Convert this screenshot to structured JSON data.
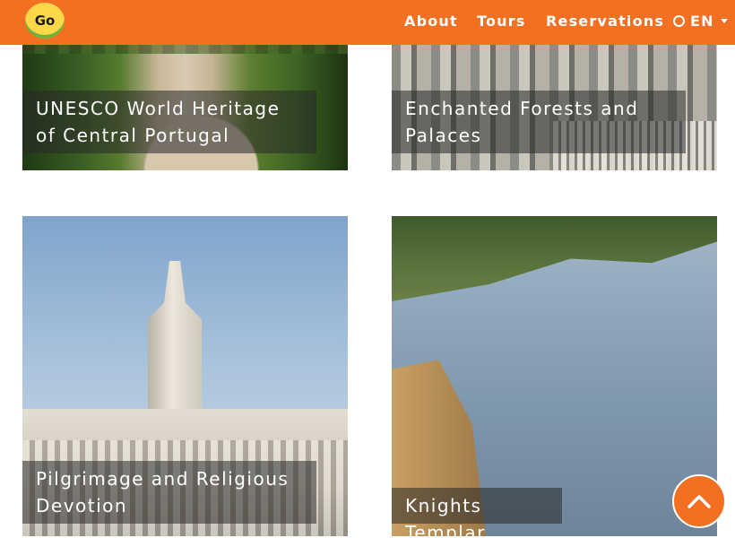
{
  "navbar": {
    "logo_text": "Go",
    "links": [
      {
        "label": "About"
      },
      {
        "label": "Tours"
      },
      {
        "label": "Reservations"
      }
    ],
    "language": "EN"
  },
  "cards": [
    {
      "title": "UNESCO World Heritage of Central Portugal"
    },
    {
      "title": "Enchanted Forests and Palaces"
    },
    {
      "title": "Pilgrimage and Religious Devotion"
    },
    {
      "title": "Knights Templar"
    }
  ],
  "colors": {
    "brand": "#f36f21",
    "caption_bg": "rgba(40,40,40,0.55)"
  },
  "icons": {
    "language": "globe-icon",
    "language_dropdown": "caret-down-icon",
    "back_to_top": "chevron-up-icon"
  }
}
